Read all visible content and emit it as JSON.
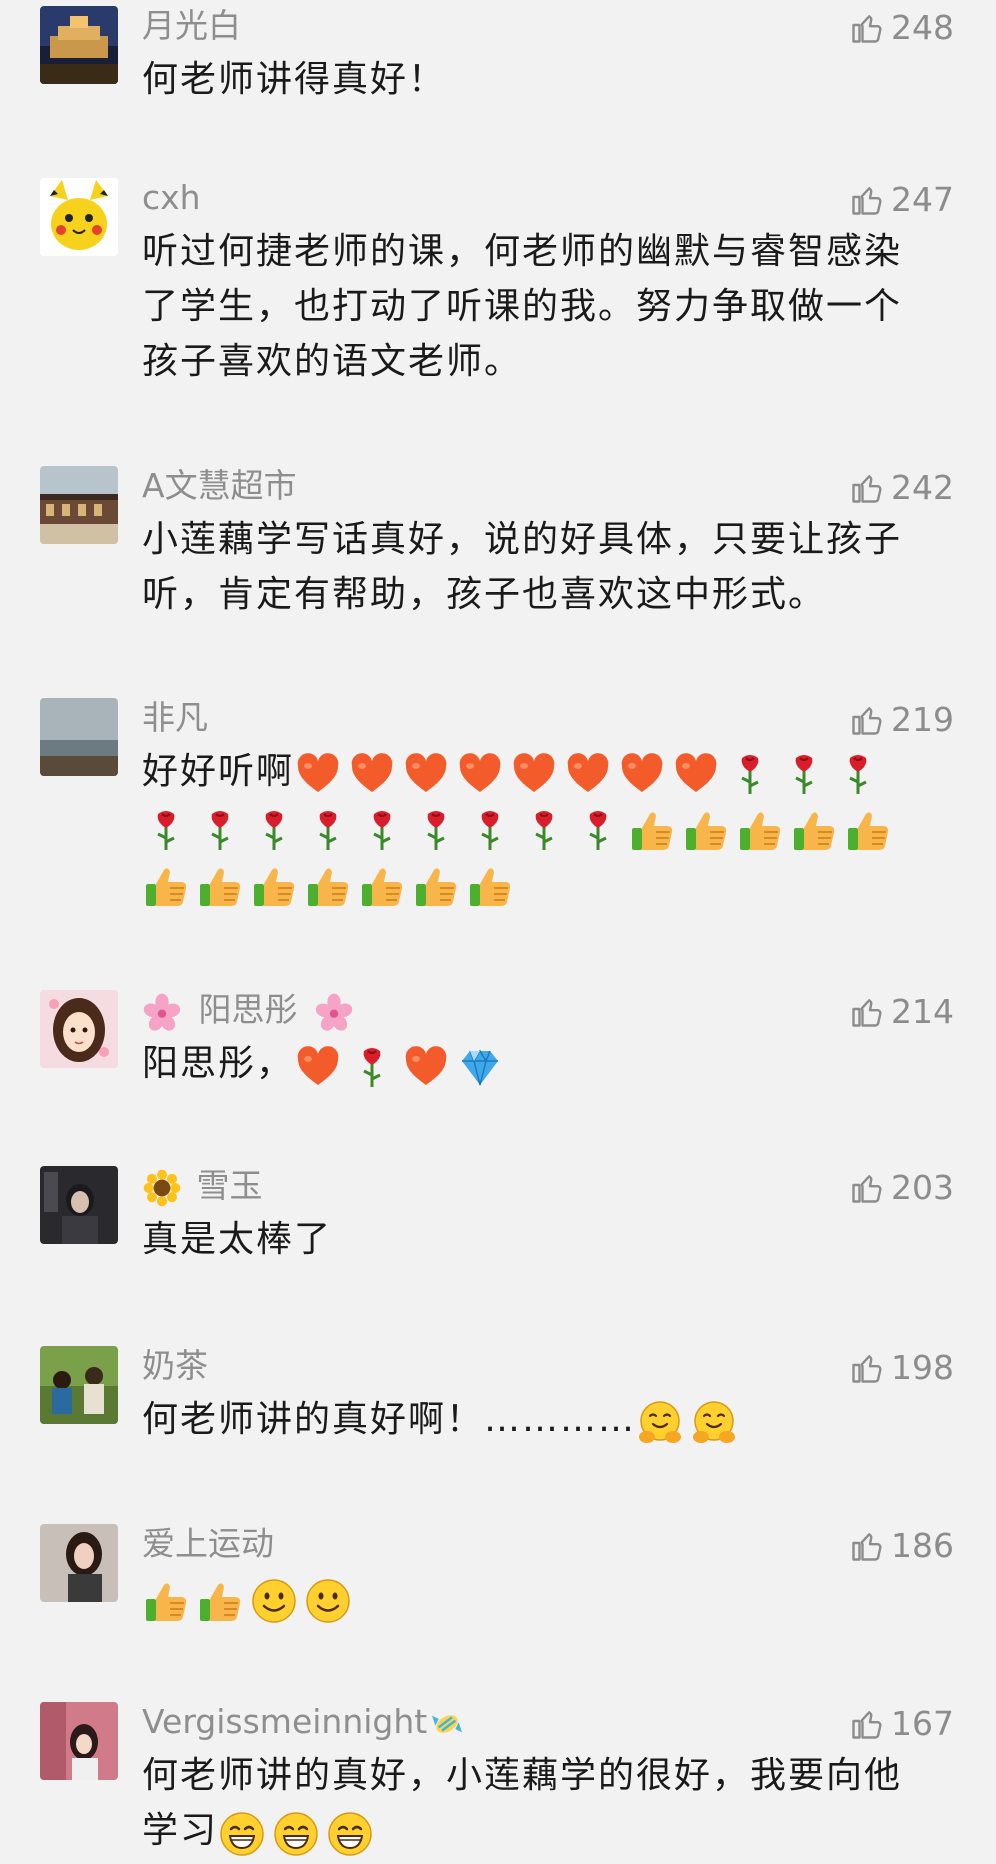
{
  "comments": [
    {
      "user": "月光白",
      "likes": "248",
      "text": "何老师讲得真好！"
    },
    {
      "user": "cxh",
      "likes": "247",
      "text": "听过何捷老师的课，何老师的幽默与睿智感染了学生，也打动了听课的我。努力争取做一个孩子喜欢的语文老师。"
    },
    {
      "user": "A文慧超市",
      "likes": "242",
      "text": "小莲藕学写话真好，说的好具体，只要让孩子听，肯定有帮助，孩子也喜欢这中形式。"
    },
    {
      "user": "非凡",
      "likes": "219",
      "text": "好好听啊"
    },
    {
      "user": "阳思彤",
      "likes": "214",
      "text": "阳思彤，"
    },
    {
      "user": "雪玉",
      "likes": "203",
      "text": "真是太棒了"
    },
    {
      "user": "奶茶",
      "likes": "198",
      "text": "何老师讲的真好啊！…………"
    },
    {
      "user": "爱上运动",
      "likes": "186",
      "text": ""
    },
    {
      "user": "Vergissmeinnight",
      "likes": "167",
      "text": "何老师讲的真好，小莲藕学的很好，我要向他学习"
    }
  ],
  "icons": {
    "like": "thumbs-up-outline-icon",
    "heart": "heart-emoji",
    "rose": "rose-emoji",
    "thumb": "thumbs-up-emoji",
    "gem": "gem-emoji",
    "smile": "smile-emoji",
    "grin": "grin-emoji",
    "hug": "hug-emoji",
    "blossom": "cherry-blossom-emoji",
    "sunflower": "sunflower-emoji",
    "candy": "candy-emoji"
  },
  "colors": {
    "background": "#f2f2f2",
    "username": "#8e8e8e",
    "text": "#1a1a1a",
    "like": "#8c8c8c"
  }
}
